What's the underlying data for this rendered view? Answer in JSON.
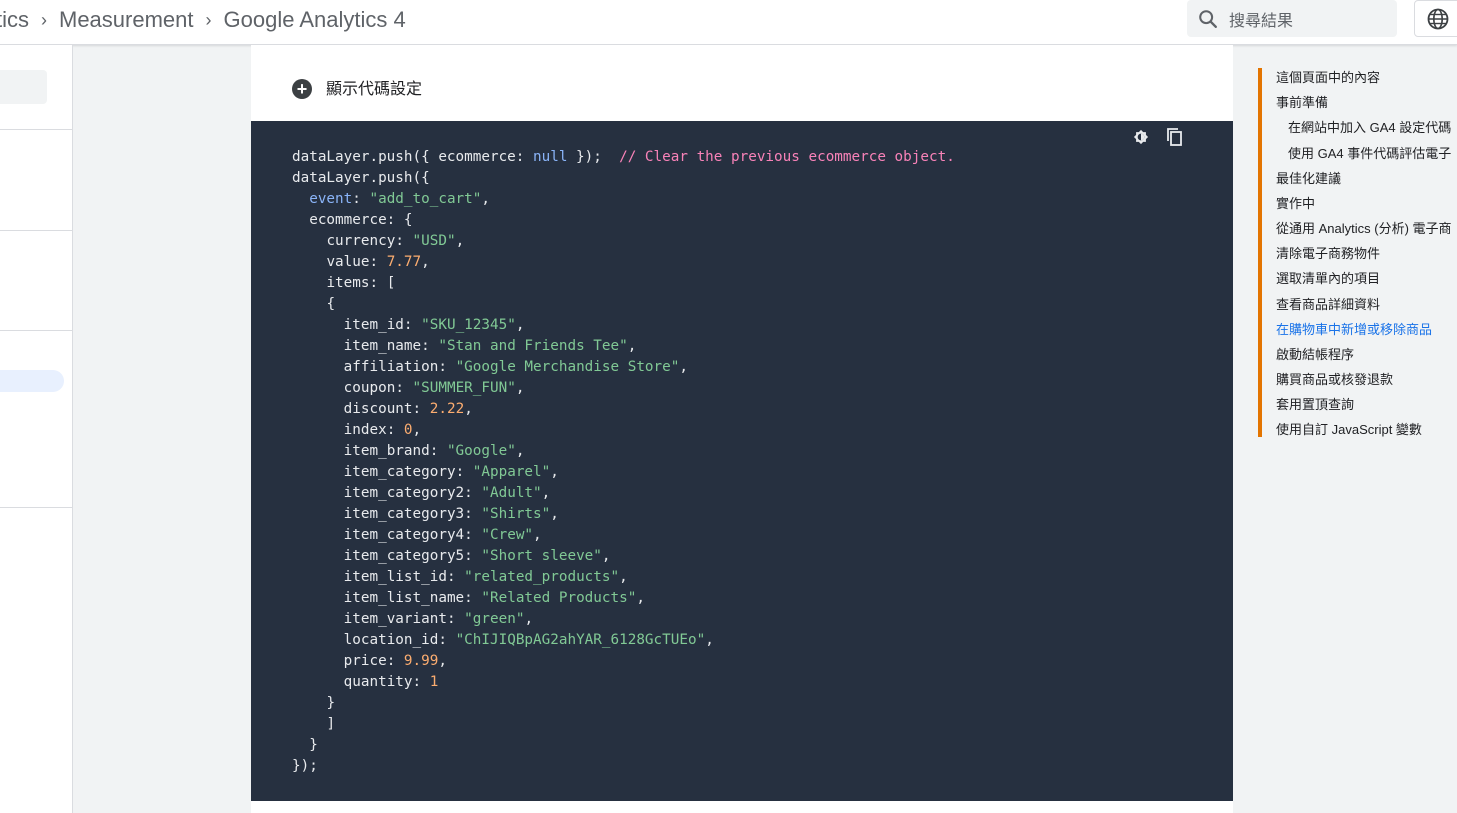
{
  "header": {
    "breadcrumbs": [
      "tics",
      "Measurement",
      "Google Analytics 4"
    ],
    "separator": "›",
    "search_placeholder": "搜尋結果",
    "search_icon": "search-icon",
    "language_icon": "globe-icon"
  },
  "main": {
    "expand_label": "顯示代碼設定",
    "expand_icon": "plus-circle-icon",
    "code_tools": {
      "theme_icon": "brightness-icon",
      "copy_icon": "copy-icon"
    },
    "code": {
      "line1_fn": "dataLayer.push({ ecommerce: ",
      "line1_null": "null",
      "line1_end": " });  ",
      "line1_comment": "// Clear the previous ecommerce object.",
      "line2": "dataLayer.push({",
      "event_key": "event",
      "event_value": "\"add_to_cart\"",
      "ecommerce_open": "ecommerce: {",
      "currency_key": "currency",
      "currency_value": "\"USD\"",
      "value_key": "value",
      "value_value": "7.77",
      "items_open": "items: [",
      "brace_open": "{",
      "item_id_key": "item_id",
      "item_id_value": "\"SKU_12345\"",
      "item_name_key": "item_name",
      "item_name_value": "\"Stan and Friends Tee\"",
      "affiliation_key": "affiliation",
      "affiliation_value": "\"Google Merchandise Store\"",
      "coupon_key": "coupon",
      "coupon_value": "\"SUMMER_FUN\"",
      "discount_key": "discount",
      "discount_value": "2.22",
      "index_key": "index",
      "index_value": "0",
      "item_brand_key": "item_brand",
      "item_brand_value": "\"Google\"",
      "item_category_key": "item_category",
      "item_category_value": "\"Apparel\"",
      "item_category2_key": "item_category2",
      "item_category2_value": "\"Adult\"",
      "item_category3_key": "item_category3",
      "item_category3_value": "\"Shirts\"",
      "item_category4_key": "item_category4",
      "item_category4_value": "\"Crew\"",
      "item_category5_key": "item_category5",
      "item_category5_value": "\"Short sleeve\"",
      "item_list_id_key": "item_list_id",
      "item_list_id_value": "\"related_products\"",
      "item_list_name_key": "item_list_name",
      "item_list_name_value": "\"Related Products\"",
      "item_variant_key": "item_variant",
      "item_variant_value": "\"green\"",
      "location_id_key": "location_id",
      "location_id_value": "\"ChIJIQBpAG2ahYAR_6128GcTUEo\"",
      "price_key": "price",
      "price_value": "9.99",
      "quantity_key": "quantity",
      "quantity_value": "1",
      "brace_close": "}",
      "bracket_close": "]",
      "ecommerce_close": "}",
      "final_close": "});"
    }
  },
  "toc": {
    "accent_color": "#e37400",
    "active_color": "#1a73e8",
    "title": "這個頁面中的內容",
    "items": [
      "事前準備",
      "在網站中加入 GA4 設定代碼",
      "使用 GA4 事件代碼評估電子",
      "最佳化建議",
      "實作中",
      "從通用 Analytics (分析) 電子商",
      "清除電子商務物件",
      "選取清單內的項目",
      "查看商品詳細資料",
      "在購物車中新增或移除商品",
      "啟動結帳程序",
      "購買商品或核發退款",
      "套用置頂查詢",
      "使用自訂 JavaScript 變數"
    ]
  }
}
